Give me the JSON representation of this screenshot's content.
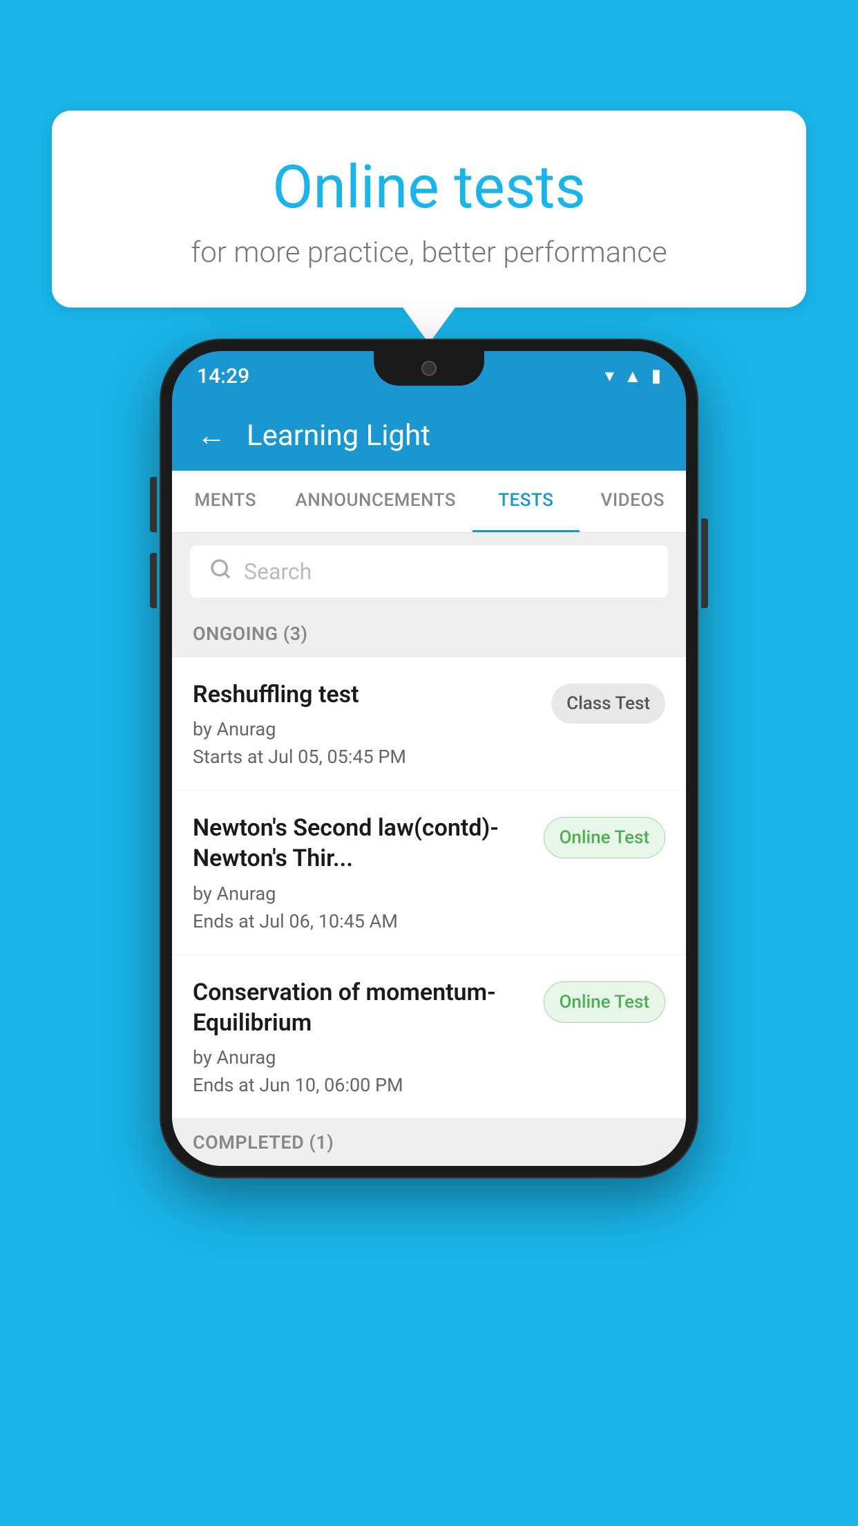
{
  "background_color": "#1ab4e8",
  "bubble": {
    "title": "Online tests",
    "subtitle": "for more practice, better performance"
  },
  "phone": {
    "status_bar": {
      "time": "14:29",
      "icons": [
        "wifi",
        "signal",
        "battery"
      ]
    },
    "header": {
      "back_label": "←",
      "title": "Learning Light"
    },
    "tabs": [
      {
        "label": "MENTS",
        "active": false
      },
      {
        "label": "ANNOUNCEMENTS",
        "active": false
      },
      {
        "label": "TESTS",
        "active": true
      },
      {
        "label": "VIDEOS",
        "active": false
      }
    ],
    "search": {
      "placeholder": "Search"
    },
    "ongoing_section": {
      "label": "ONGOING (3)"
    },
    "tests": [
      {
        "name": "Reshuffling test",
        "author": "by Anurag",
        "time_label": "Starts at",
        "time": "Jul 05, 05:45 PM",
        "badge": "Class Test",
        "badge_type": "class"
      },
      {
        "name": "Newton's Second law(contd)-Newton's Thir...",
        "author": "by Anurag",
        "time_label": "Ends at",
        "time": "Jul 06, 10:45 AM",
        "badge": "Online Test",
        "badge_type": "online"
      },
      {
        "name": "Conservation of momentum-Equilibrium",
        "author": "by Anurag",
        "time_label": "Ends at",
        "time": "Jun 10, 06:00 PM",
        "badge": "Online Test",
        "badge_type": "online"
      }
    ],
    "completed_section": {
      "label": "COMPLETED (1)"
    }
  }
}
